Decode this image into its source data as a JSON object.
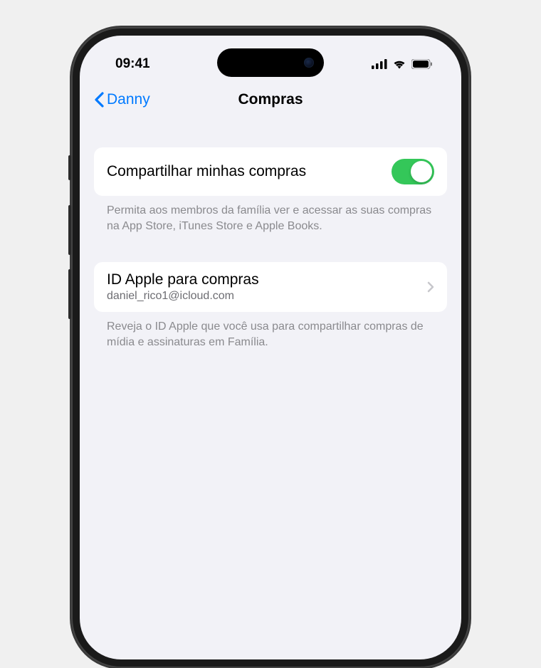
{
  "status_bar": {
    "time": "09:41"
  },
  "nav": {
    "back_label": "Danny",
    "title": "Compras"
  },
  "share_purchases": {
    "label": "Compartilhar minhas compras",
    "toggle_on": true,
    "footer": "Permita aos membros da família ver e acessar as suas compras na App Store, iTunes Store e Apple Books."
  },
  "apple_id": {
    "title": "ID Apple para compras",
    "email": "daniel_rico1@icloud.com",
    "footer": "Reveja o ID Apple que você usa para compartilhar compras de mídia e assinaturas em Família."
  },
  "colors": {
    "accent": "#007aff",
    "toggle_on": "#34c759",
    "background": "#f2f2f7",
    "cell_bg": "#ffffff",
    "footer_text": "#8a8a8e"
  }
}
